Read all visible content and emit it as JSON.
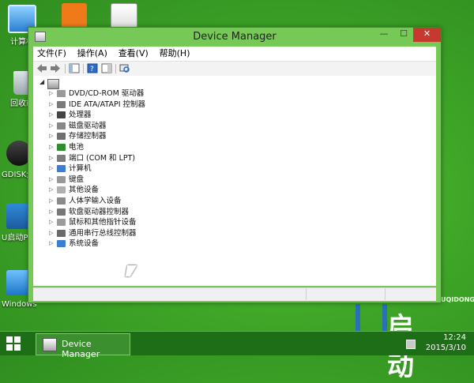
{
  "desktop": {
    "icons": [
      {
        "label": "计算机",
        "icon": "computer-icon"
      },
      {
        "label": "回收站",
        "icon": "recycle-bin-icon"
      },
      {
        "label": "GDISK分区",
        "icon": "diskgenius-icon"
      },
      {
        "label": "U启动PE工具",
        "icon": "uqidong-icon"
      },
      {
        "label": "Windows安装器",
        "icon": "windows-installer-icon"
      },
      {
        "label": "",
        "icon": "orange-g-icon"
      },
      {
        "label": "",
        "icon": "toolkit-icon"
      }
    ],
    "brand": {
      "text": "启动",
      "url": "UQIDONG.COM"
    }
  },
  "window": {
    "title": "Device Manager",
    "controls": {
      "minimize": "—",
      "maximize": "☐",
      "close": "✕"
    },
    "menu": [
      "文件(F)",
      "操作(A)",
      "查看(V)",
      "帮助(H)"
    ],
    "toolbar": [
      "back-arrow-icon",
      "forward-arrow-icon",
      "show-hide-console-tree-icon",
      "properties-icon",
      "help-icon",
      "action-pane-icon",
      "scan-hardware-icon"
    ],
    "tree": {
      "root_icon": "computer-root-icon",
      "items": [
        {
          "label": "DVD/CD-ROM 驱动器",
          "icon": "dvd-drive-icon",
          "color": "#9a9a9a"
        },
        {
          "label": "IDE ATA/ATAPI 控制器",
          "icon": "ide-controller-icon",
          "color": "#7a7a7a"
        },
        {
          "label": "处理器",
          "icon": "processor-icon",
          "color": "#444444"
        },
        {
          "label": "磁盘驱动器",
          "icon": "disk-drive-icon",
          "color": "#888888"
        },
        {
          "label": "存储控制器",
          "icon": "storage-controller-icon",
          "color": "#6f6f6f"
        },
        {
          "label": "电池",
          "icon": "battery-icon",
          "color": "#2f8d2f"
        },
        {
          "label": "端口 (COM 和 LPT)",
          "icon": "port-icon",
          "color": "#7c7c7c"
        },
        {
          "label": "计算机",
          "icon": "computer-icon",
          "color": "#3a7fd0"
        },
        {
          "label": "键盘",
          "icon": "keyboard-icon",
          "color": "#999999"
        },
        {
          "label": "其他设备",
          "icon": "other-devices-icon",
          "color": "#b0b0b0"
        },
        {
          "label": "人体学输入设备",
          "icon": "hid-icon",
          "color": "#8a8a8a"
        },
        {
          "label": "软盘驱动器控制器",
          "icon": "floppy-controller-icon",
          "color": "#777777"
        },
        {
          "label": "鼠标和其他指针设备",
          "icon": "mouse-icon",
          "color": "#9c9c9c"
        },
        {
          "label": "通用串行总线控制器",
          "icon": "usb-controller-icon",
          "color": "#6a6a6a"
        },
        {
          "label": "系统设备",
          "icon": "system-devices-icon",
          "color": "#3a7fd0"
        }
      ]
    }
  },
  "taskbar": {
    "task_label": "Device Manager",
    "time": "12:24",
    "date": "2015/3/10"
  }
}
